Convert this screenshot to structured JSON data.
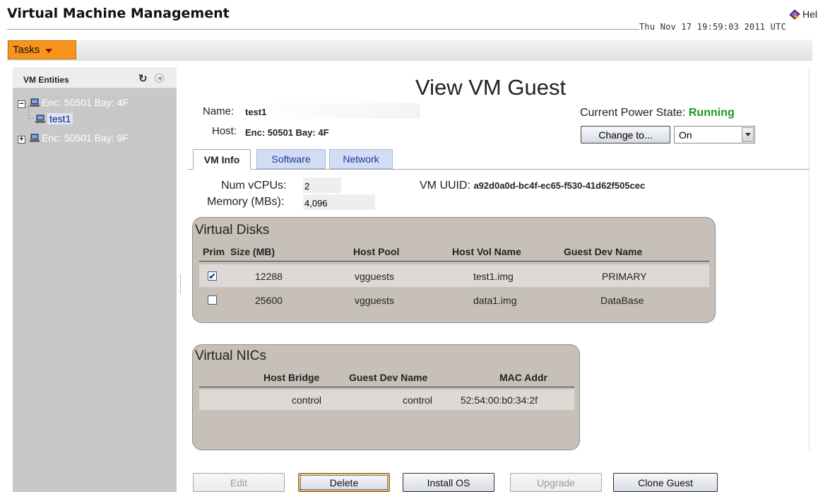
{
  "header": {
    "title": "Virtual Machine Management",
    "help_label": "Help",
    "timestamp": "Thu Nov 17 19:59:03 2011 UTC"
  },
  "toolbar": {
    "tasks_label": "Tasks"
  },
  "sidebar": {
    "title": "VM Entities",
    "tree": [
      {
        "label": "Enc: 50501 Bay: 4F",
        "toggle": "−",
        "expanded": true
      },
      {
        "label": "test1",
        "selected": true
      },
      {
        "label": "Enc: 50501 Bay: 9F",
        "toggle": "+",
        "expanded": false
      }
    ]
  },
  "main": {
    "page_title": "View VM Guest",
    "name_label": "Name:",
    "name_value": "test1",
    "host_label": "Host:",
    "host_value": "Enc: 50501 Bay: 4F",
    "power_label": "Current Power State:",
    "power_value": "Running",
    "change_button": "Change to...",
    "power_select_value": "On",
    "tabs": [
      {
        "label": "VM Info",
        "active": true
      },
      {
        "label": "Software",
        "active": false
      },
      {
        "label": "Network",
        "active": false
      }
    ],
    "vcpus_label": "Num vCPUs:",
    "vcpus_value": "2",
    "memory_label": "Memory (MBs):",
    "memory_value": "4,096",
    "uuid_label": "VM UUID:",
    "uuid_value": "a92d0a0d-bc4f-ec65-f530-41d62f505cec"
  },
  "disks": {
    "title": "Virtual Disks",
    "columns": [
      "Prim",
      "Size (MB)",
      "Host Pool",
      "Host Vol Name",
      "Guest Dev Name"
    ],
    "rows": [
      {
        "prim": true,
        "size": "12288",
        "pool": "vgguests",
        "vol": "test1.img",
        "dev": "PRIMARY"
      },
      {
        "prim": false,
        "size": "25600",
        "pool": "vgguests",
        "vol": "data1.img",
        "dev": "DataBase"
      }
    ]
  },
  "nics": {
    "title": "Virtual NICs",
    "columns": [
      "Host Bridge",
      "Guest Dev Name",
      "MAC Addr"
    ],
    "rows": [
      {
        "bridge": "control",
        "dev": "control",
        "mac": "52:54:00:b0:34:2f"
      }
    ]
  },
  "actions": {
    "edit": "Edit",
    "delete": "Delete",
    "install_os": "Install OS",
    "upgrade": "Upgrade",
    "clone": "Clone Guest"
  },
  "colors": {
    "tasks_accent": "#f7941d",
    "running_status": "#1d9a1d",
    "sidebar_bg": "#c8c8c8",
    "group_box_bg": "#c7c0b9"
  }
}
